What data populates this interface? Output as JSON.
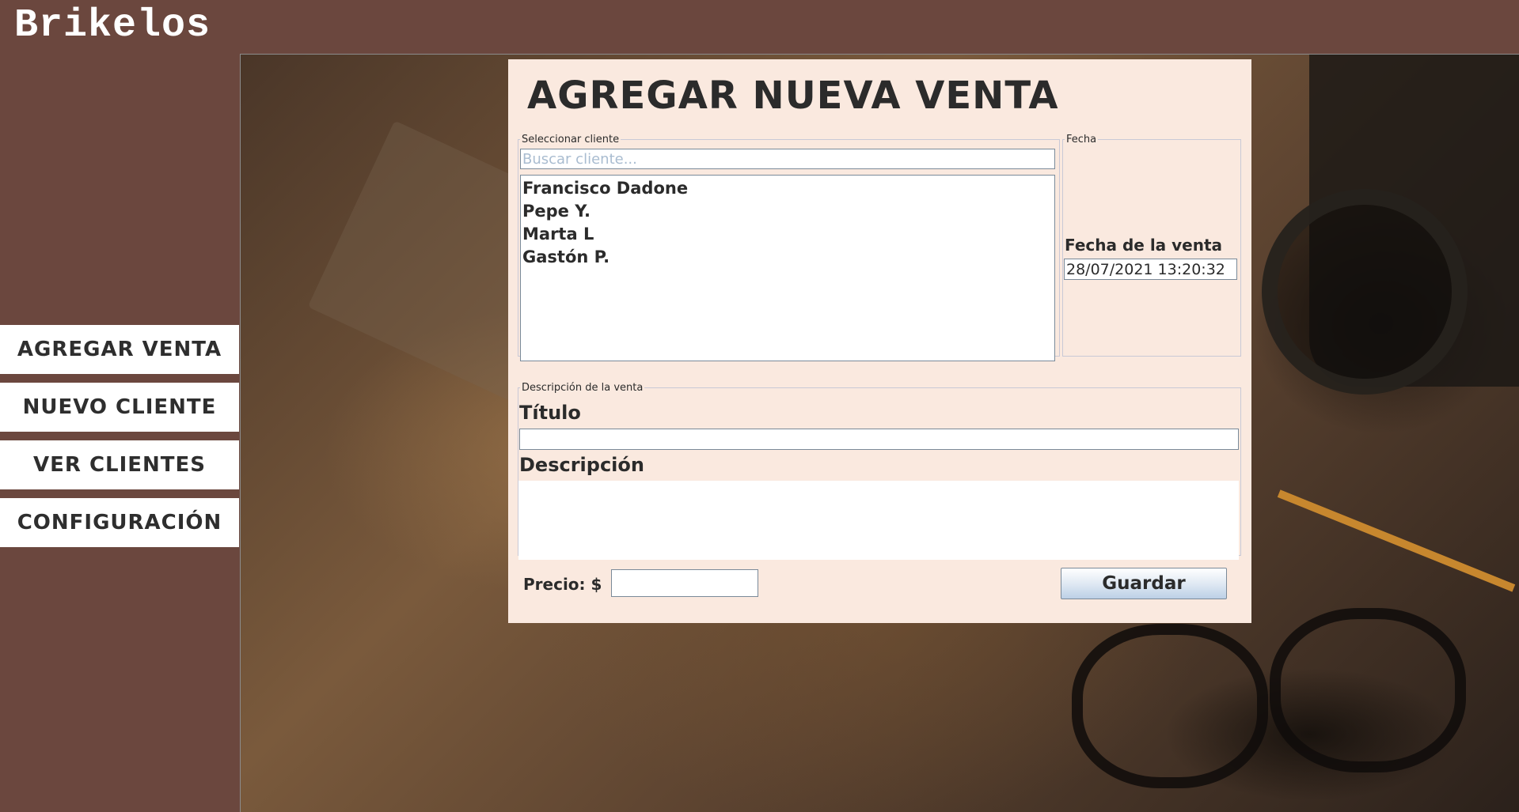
{
  "app": {
    "title": "Brikelos"
  },
  "nav": {
    "items": [
      {
        "label": "AGREGAR VENTA"
      },
      {
        "label": "NUEVO CLIENTE"
      },
      {
        "label": "VER CLIENTES"
      },
      {
        "label": "CONFIGURACIÓN"
      }
    ]
  },
  "form": {
    "title": "AGREGAR NUEVA VENTA",
    "cliente": {
      "legend": "Seleccionar cliente",
      "search_placeholder": "Buscar cliente...",
      "search_value": "",
      "clients": [
        "Francisco Dadone",
        "Pepe Y.",
        "Marta L",
        "Gastón P."
      ]
    },
    "fecha": {
      "legend": "Fecha",
      "label": "Fecha de la venta",
      "value": "28/07/2021 13:20:32"
    },
    "descripcion": {
      "legend": "Descripción de la venta",
      "titulo_label": "Título",
      "titulo_value": "",
      "descripcion_label": "Descripción",
      "descripcion_value": ""
    },
    "precio": {
      "label": "Precio: $",
      "value": ""
    },
    "save_label": "Guardar"
  }
}
